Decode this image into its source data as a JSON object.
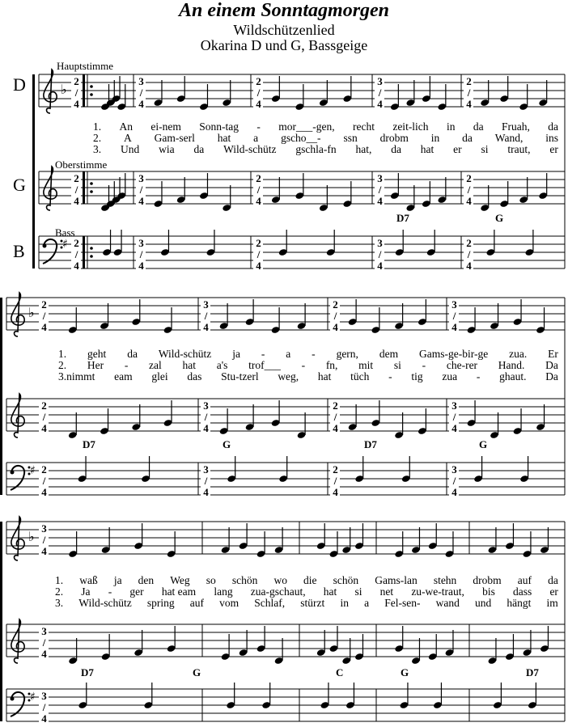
{
  "title": "An einem Sonntagmorgen",
  "subtitle": "Wildschützenlied",
  "instrumentation": "Okarina D und G, Bassgeige",
  "parts": [
    {
      "abbr": "D",
      "name": "Hauptstimme"
    },
    {
      "abbr": "G",
      "name": "Oberstimme"
    },
    {
      "abbr": "B",
      "name": "Bass"
    }
  ],
  "systems": [
    {
      "lyrics": [
        [
          "1.",
          "An",
          "ei-nem",
          "Sonn-tag",
          "-",
          "mor___-gen,",
          "recht",
          "zeit-lich",
          "in",
          "da",
          "Fruah,",
          "da"
        ],
        [
          "2.",
          "A",
          "Gam-serl",
          "hat",
          "a",
          "gscho__-",
          "ssn",
          "drobm",
          "in",
          "da",
          "Wand,",
          "ins"
        ],
        [
          "3.",
          "Und",
          "wia",
          "da",
          "Wild-schütz",
          "gschla-fn",
          "hat,",
          "da",
          "hat",
          "er",
          "si",
          "traut,",
          "er"
        ]
      ],
      "chords": [
        "D7",
        "G"
      ]
    },
    {
      "lyrics": [
        [
          "1.",
          "geht",
          "da",
          "Wild-schütz",
          "ja",
          "-",
          "a",
          "-",
          "gern,",
          "dem",
          "Gams-ge-bir-ge",
          "zua.",
          "Er"
        ],
        [
          "2.",
          "Her",
          "-",
          "zal",
          "hat",
          "a's",
          "trof___",
          "-",
          "fn,",
          "mit",
          "si",
          "-",
          "che-rer",
          "Hand.",
          "Da"
        ],
        [
          "3.nimmt",
          "eam",
          "glei",
          "das",
          "Stu-tzerl",
          "weg,",
          "hat",
          "tüch",
          "-",
          "tig",
          "zua",
          "-",
          "ghaut.",
          "Da"
        ]
      ],
      "chords": [
        "D7",
        "G",
        "D7",
        "G"
      ]
    },
    {
      "lyrics": [
        [
          "1.",
          "waß",
          "ja",
          "den",
          "Weg",
          "so",
          "schön",
          "wo",
          "die",
          "schön",
          "Gams-lan",
          "stehn",
          "drobm",
          "auf",
          "da"
        ],
        [
          "2.",
          "Ja",
          "-",
          "ger",
          "hat eam",
          "lang",
          "zua-gschaut,",
          "hat",
          "si",
          "net",
          "zu-we-traut,",
          "bis",
          "dass",
          "er"
        ],
        [
          "3.",
          "Wild-schütz",
          "spring",
          "auf",
          "vom",
          "Schlaf,",
          "stürzt",
          "in",
          "a",
          "Fel-sen-",
          "wand",
          "und",
          "hängt",
          "im"
        ]
      ],
      "chords": [
        "D7",
        "G",
        "C",
        "G",
        "D7"
      ]
    }
  ],
  "time_signatures": [
    "2/4",
    "3/4"
  ]
}
